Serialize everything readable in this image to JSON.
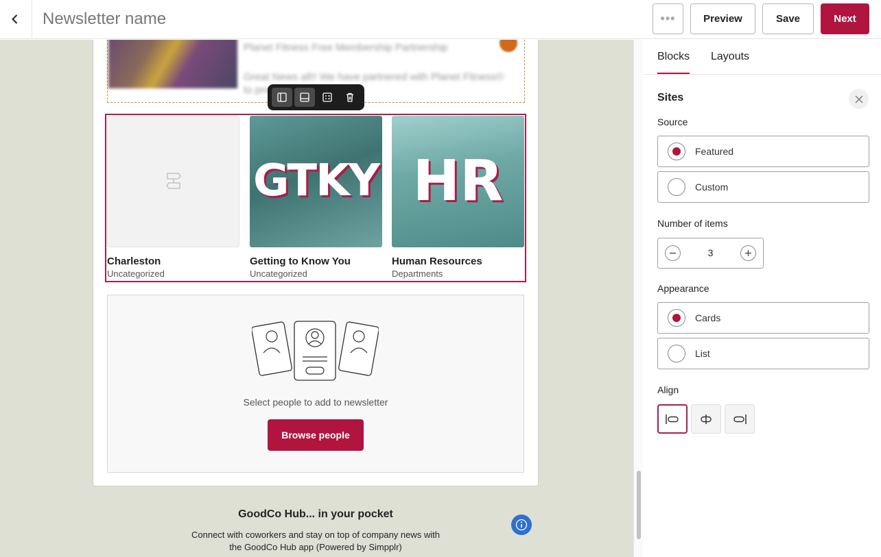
{
  "header": {
    "title": "Newsletter name",
    "more_label": "•••",
    "preview_label": "Preview",
    "save_label": "Save",
    "next_label": "Next"
  },
  "canvas": {
    "article": {
      "title": "Planet Fitness Free Membership Partnership",
      "body": "Great News all!! We have partnered with Planet Fitness© to provide Free Classic..."
    },
    "sites": [
      {
        "name": "Charleston",
        "category": "Uncategorized",
        "image_text": ""
      },
      {
        "name": "Getting to Know You",
        "category": "Uncategorized",
        "image_text": "GTKY"
      },
      {
        "name": "Human Resources",
        "category": "Departments",
        "image_text": "HR"
      }
    ],
    "people": {
      "prompt": "Select people to add to newsletter",
      "button_label": "Browse people"
    },
    "footer": {
      "title": "GoodCo Hub... in your pocket",
      "line1": "Connect with coworkers and stay on top of company news with",
      "line2": "the GoodCo Hub app (Powered by Simpplr)"
    }
  },
  "panel": {
    "tabs": [
      "Blocks",
      "Layouts"
    ],
    "active_tab": "Blocks",
    "title": "Sites",
    "source": {
      "label": "Source",
      "options": [
        "Featured",
        "Custom"
      ],
      "selected": "Featured"
    },
    "items": {
      "label": "Number of items",
      "value": "3"
    },
    "appearance": {
      "label": "Appearance",
      "options": [
        "Cards",
        "List"
      ],
      "selected": "Cards"
    },
    "align": {
      "label": "Align",
      "options": [
        "left",
        "center",
        "right"
      ],
      "selected": "left"
    }
  },
  "colors": {
    "accent": "#b1143f",
    "canvas_bg": "#dfe0d4",
    "info_blue": "#2f6fd0"
  },
  "icons": [
    "chevron-left-icon",
    "more-icon",
    "layout-sidebar-icon",
    "layout-bottom-icon",
    "layout-list-icon",
    "trash-icon",
    "image-placeholder-icon",
    "info-icon",
    "close-icon",
    "minus-icon",
    "plus-icon",
    "align-left-icon",
    "align-center-icon",
    "align-right-icon"
  ]
}
